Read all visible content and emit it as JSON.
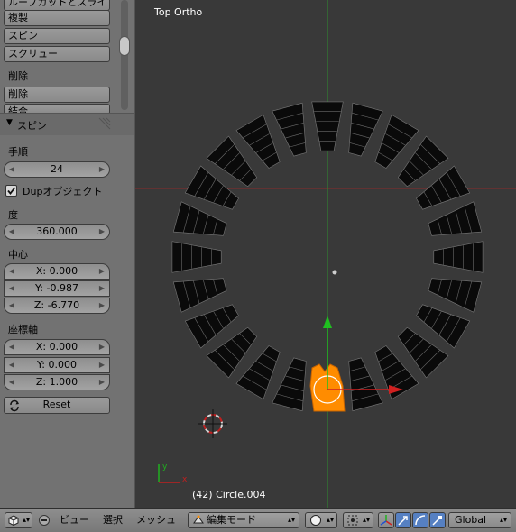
{
  "toolshelf": {
    "buttons_top": [
      "ループカットとスライ",
      "複製",
      "スピン",
      "スクリュー"
    ],
    "delete_label": "削除",
    "delete_buttons": [
      "削除",
      "結合"
    ],
    "panel_title": "スピン",
    "steps_label": "手順",
    "steps_value": "24",
    "dup_label": "Dupオブジェクト",
    "dup_checked": true,
    "degrees_label": "度",
    "degrees_value": "360.000",
    "center_label": "中心",
    "center_x": "X: 0.000",
    "center_y": "Y: -0.987",
    "center_z": "Z: -6.770",
    "axis_label": "座標軸",
    "axis_x": "X: 0.000",
    "axis_y": "Y: 0.000",
    "axis_z": "Z: 1.000",
    "reset_label": "Reset"
  },
  "viewport": {
    "view_name": "Top Ortho",
    "object_info": "(42) Circle.004",
    "spin_steps": 24
  },
  "header": {
    "menu_view": "ビュー",
    "menu_select": "選択",
    "menu_mesh": "メッシュ",
    "mode": "編集モード",
    "orientation": "Global"
  },
  "colors": {
    "background": "#393939",
    "panel": "#727272",
    "selected_mesh": "#ff8c00",
    "x_axis": "#c02020",
    "y_axis": "#20a020"
  }
}
